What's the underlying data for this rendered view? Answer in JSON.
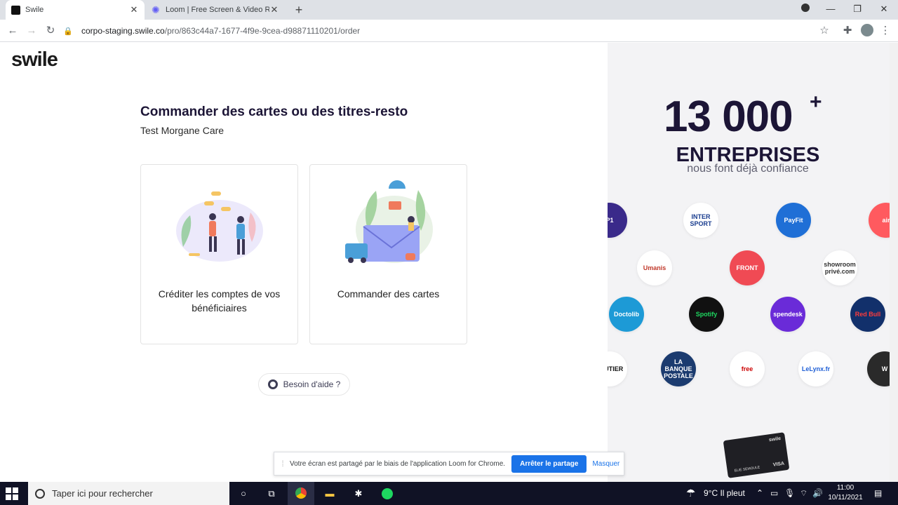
{
  "browser": {
    "tabs": [
      {
        "title": "Swile",
        "active": true
      },
      {
        "title": "Loom | Free Screen & Video Rec",
        "active": false
      }
    ],
    "address": {
      "domain": "corpo-staging.swile.co",
      "path": "/pro/863c44a7-1677-4f9e-9cea-d98871110201/order"
    }
  },
  "page": {
    "logo": "swile",
    "title": "Commander des cartes ou des titres-resto",
    "subtitle": "Test Morgane Care",
    "cards": [
      {
        "label": "Créditer les comptes de vos bénéficiaires"
      },
      {
        "label": "Commander des cartes"
      }
    ],
    "help_label": "Besoin d'aide ?"
  },
  "panel": {
    "big_number": "13 000",
    "plus": "+",
    "headline": "ENTREPRISES",
    "tagline": "nous font déjà confiance",
    "logos": [
      {
        "text": "P1",
        "color": "#3a2a8a",
        "fg": "#ffffff"
      },
      {
        "text": "INTER SPORT",
        "color": "#ffffff",
        "fg": "#1a3d8f"
      },
      {
        "text": "PayFit",
        "color": "#1f6fd6",
        "fg": "#ffffff"
      },
      {
        "text": "air",
        "color": "#ff5a5f",
        "fg": "#ffffff"
      },
      {
        "text": "Umanis",
        "color": "#ffffff",
        "fg": "#c0392b"
      },
      {
        "text": "FRONT",
        "color": "#f04a54",
        "fg": "#ffffff"
      },
      {
        "text": "showroom privé.com",
        "color": "#ffffff",
        "fg": "#333333"
      },
      {
        "text": "Doctolib",
        "color": "#1d9ad6",
        "fg": "#ffffff"
      },
      {
        "text": "Spotify",
        "color": "#111111",
        "fg": "#1ed760"
      },
      {
        "text": "spendesk",
        "color": "#6a2bd8",
        "fg": "#ffffff"
      },
      {
        "text": "Red Bull",
        "color": "#12306b",
        "fg": "#ff3b3b"
      },
      {
        "text": "FEUTIER",
        "color": "#ffffff",
        "fg": "#111111"
      },
      {
        "text": "LA BANQUE POSTALE",
        "color": "#1b3b6f",
        "fg": "#ffffff"
      },
      {
        "text": "free",
        "color": "#ffffff",
        "fg": "#cc0000"
      },
      {
        "text": "LeLynx.fr",
        "color": "#ffffff",
        "fg": "#1f5fd6"
      },
      {
        "text": "W",
        "color": "#2a2a2a",
        "fg": "#ffffff"
      }
    ],
    "card_brand": "swile",
    "card_name": "ELIE SEMOULE",
    "card_network": "VISA"
  },
  "loom": {
    "message": "Votre écran est partagé par le biais de l'application Loom for Chrome.",
    "stop": "Arrêter le partage",
    "hide": "Masquer"
  },
  "taskbar": {
    "search_placeholder": "Taper ici pour rechercher",
    "weather": "9°C  Il pleut",
    "time": "11:00",
    "date": "10/11/2021"
  }
}
